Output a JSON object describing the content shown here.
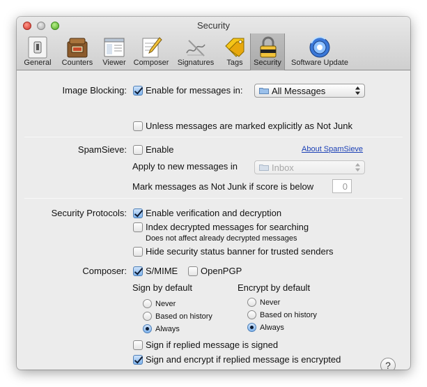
{
  "window": {
    "title": "Security"
  },
  "toolbar": {
    "items": [
      {
        "label": "General",
        "icon": "light-switch-icon"
      },
      {
        "label": "Counters",
        "icon": "mailbox-counter-icon"
      },
      {
        "label": "Viewer",
        "icon": "window-viewer-icon"
      },
      {
        "label": "Composer",
        "icon": "pencil-paper-icon"
      },
      {
        "label": "Signatures",
        "icon": "signature-pen-icon"
      },
      {
        "label": "Tags",
        "icon": "tag-icon"
      },
      {
        "label": "Security",
        "icon": "padlock-icon"
      },
      {
        "label": "Software Update",
        "icon": "refresh-globe-icon"
      }
    ],
    "selected": "Security"
  },
  "image_blocking": {
    "label": "Image Blocking:",
    "enable_label": "Enable for messages in:",
    "enable_checked": true,
    "mailbox_value": "All Messages",
    "unless_label": "Unless messages are marked explicitly as Not Junk",
    "unless_checked": false
  },
  "spamsieve": {
    "label": "SpamSieve:",
    "enable_label": "Enable",
    "enable_checked": false,
    "about_link": "About SpamSieve",
    "apply_label": "Apply to new messages in",
    "apply_value": "Inbox",
    "mark_label": "Mark messages as Not Junk if score is below",
    "score_value": "0"
  },
  "security_protocols": {
    "label": "Security Protocols:",
    "verify_label": "Enable verification and decryption",
    "verify_checked": true,
    "index_label": "Index decrypted messages for searching",
    "index_checked": false,
    "index_note": "Does not affect already decrypted messages",
    "hide_label": "Hide security status banner for trusted senders",
    "hide_checked": false
  },
  "composer": {
    "label": "Composer:",
    "smime_label": "S/MIME",
    "smime_checked": true,
    "openpgp_label": "OpenPGP",
    "openpgp_checked": false,
    "sign_title": "Sign by default",
    "sign_options": [
      "Never",
      "Based on history",
      "Always"
    ],
    "sign_selected": "Always",
    "encrypt_title": "Encrypt by default",
    "encrypt_options": [
      "Never",
      "Based on history",
      "Always"
    ],
    "encrypt_selected": "Always",
    "sign_replied_label": "Sign if replied message is signed",
    "sign_replied_checked": false,
    "sign_encrypt_label": "Sign and encrypt if replied message is encrypted",
    "sign_encrypt_checked": true
  },
  "help": {
    "label": "?"
  }
}
